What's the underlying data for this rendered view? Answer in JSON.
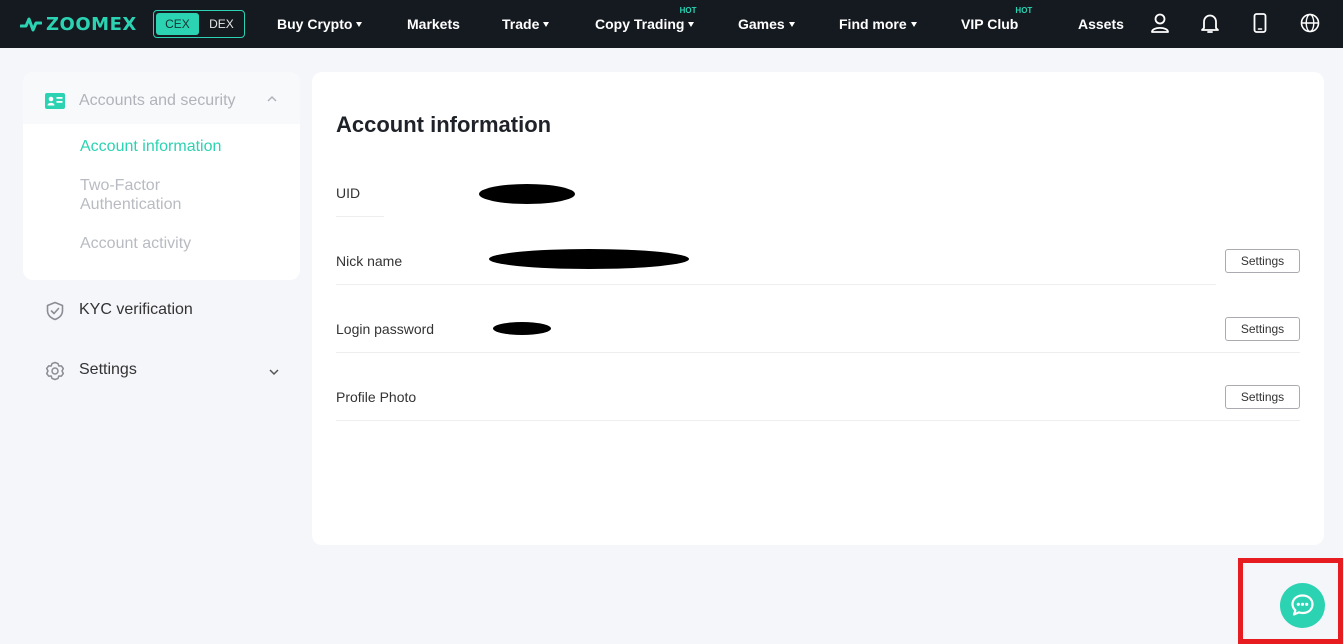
{
  "nav": {
    "logo_text": "ZOOMEX",
    "switch": {
      "cex": "CEX",
      "dex": "DEX"
    },
    "items": [
      {
        "label": "Buy Crypto",
        "dropdown": true
      },
      {
        "label": "Markets"
      },
      {
        "label": "Trade",
        "dropdown": true
      },
      {
        "label": "Copy Trading",
        "dropdown": true,
        "badge": "HOT"
      },
      {
        "label": "Games",
        "dropdown": true
      },
      {
        "label": "Find more",
        "dropdown": true
      },
      {
        "label": "VIP Club",
        "badge": "HOT"
      },
      {
        "label": "Assets"
      }
    ],
    "icons": [
      "user-icon",
      "bell-icon",
      "mobile-icon",
      "globe-icon"
    ]
  },
  "sidebar": {
    "group": {
      "label": "Accounts and security",
      "icon": "id-card-icon",
      "items": [
        {
          "label": "Account information",
          "active": true
        },
        {
          "label": "Two-Factor Authentication"
        },
        {
          "label": "Account activity"
        }
      ]
    },
    "kyc": {
      "label": "KYC verification",
      "icon": "shield-check-icon"
    },
    "settings": {
      "label": "Settings",
      "icon": "gear-icon"
    }
  },
  "main": {
    "title": "Account information",
    "rows": [
      {
        "label": "UID"
      },
      {
        "label": "Nick name",
        "button": "Settings"
      },
      {
        "label": "Login password",
        "button": "Settings"
      },
      {
        "label": "Profile Photo",
        "button": "Settings"
      }
    ]
  },
  "colors": {
    "accent": "#2bd3b3",
    "nav_bg": "#151a21",
    "highlight": "#e61c21"
  }
}
